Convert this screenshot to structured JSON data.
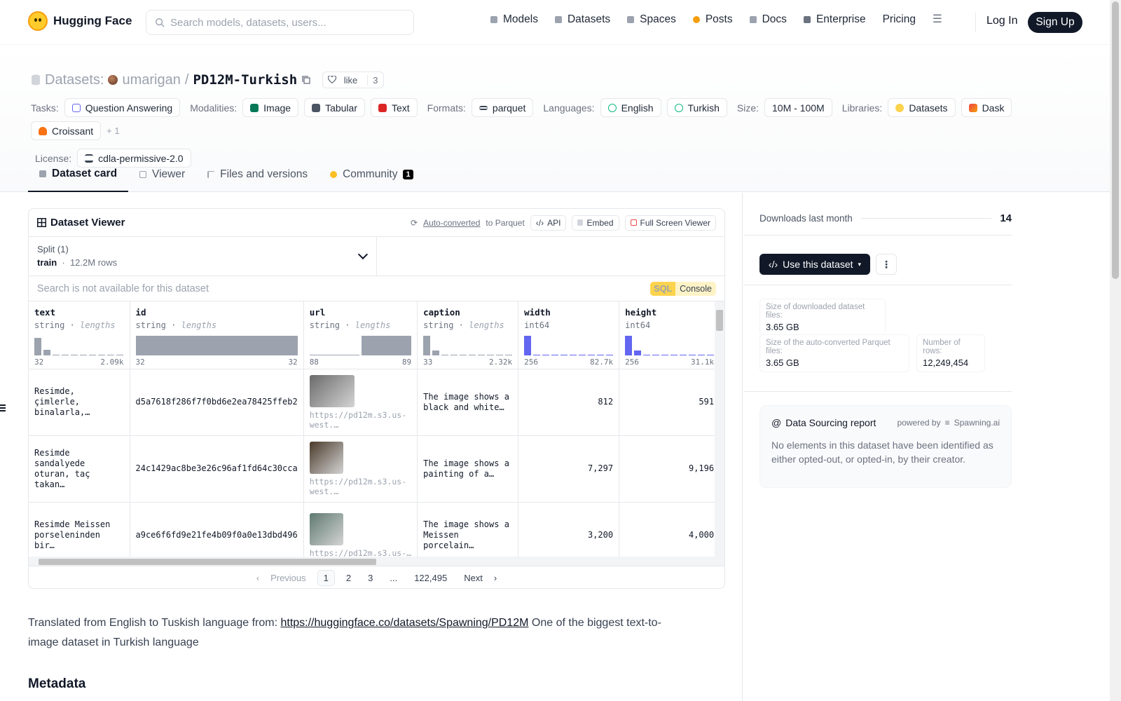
{
  "header": {
    "brand": "Hugging Face",
    "search_placeholder": "Search models, datasets, users...",
    "nav": [
      {
        "label": "Models",
        "icon": "cube-icon",
        "color": "#9ca3af"
      },
      {
        "label": "Datasets",
        "icon": "database-icon",
        "color": "#9ca3af"
      },
      {
        "label": "Spaces",
        "icon": "grid-icon",
        "color": "#9ca3af"
      },
      {
        "label": "Posts",
        "icon": "chat-icon",
        "color": "#f59e0b"
      },
      {
        "label": "Docs",
        "icon": "docs-icon",
        "color": "#9ca3af"
      },
      {
        "label": "Enterprise",
        "icon": "enterprise-icon",
        "color": "#6b7280"
      },
      {
        "label": "Pricing",
        "icon": "",
        "color": ""
      }
    ],
    "login": "Log In",
    "signup": "Sign Up"
  },
  "dataset": {
    "section_label": "Datasets:",
    "owner": "umarigan",
    "separator": "/",
    "name": "PD12M-Turkish",
    "like_label": "like",
    "like_count": "3",
    "tags": {
      "tasks_label": "Tasks:",
      "tasks": [
        "Question Answering"
      ],
      "modalities_label": "Modalities:",
      "modalities": [
        "Image",
        "Tabular",
        "Text"
      ],
      "formats_label": "Formats:",
      "formats": [
        "parquet"
      ],
      "languages_label": "Languages:",
      "languages": [
        "English",
        "Turkish"
      ],
      "size_label": "Size:",
      "size": "10M - 100M",
      "libraries_label": "Libraries:",
      "libraries": [
        "Datasets",
        "Dask",
        "Croissant"
      ],
      "libraries_more": "+ 1",
      "license_label": "License:",
      "license": "cdla-permissive-2.0"
    },
    "tabs": [
      {
        "label": "Dataset card",
        "active": true
      },
      {
        "label": "Viewer",
        "active": false
      },
      {
        "label": "Files and versions",
        "active": false
      },
      {
        "label": "Community",
        "active": false,
        "badge": "1"
      }
    ]
  },
  "viewer": {
    "title": "Dataset Viewer",
    "auto_converted": "Auto-converted",
    "to_parquet": "to Parquet",
    "api": "API",
    "embed": "Embed",
    "full_screen": "Full Screen Viewer",
    "split_label": "Split (1)",
    "split_name": "train",
    "split_rows": "12.2M rows",
    "search_disabled": "Search is not available for this dataset",
    "sql": "SQL",
    "console": "Console",
    "columns": [
      {
        "name": "text",
        "type": "string",
        "stat": "lengths",
        "min": "32",
        "max": "2.09k",
        "hist": [
          0.9,
          0.3,
          0.05,
          0.05,
          0.05,
          0.05,
          0.05,
          0.05,
          0.05,
          0.05
        ]
      },
      {
        "name": "id",
        "type": "string",
        "stat": "lengths",
        "min": "32",
        "max": "32",
        "hist": [
          1
        ]
      },
      {
        "name": "url",
        "type": "string",
        "stat": "lengths",
        "min": "88",
        "max": "89",
        "hist": [
          0.05,
          1
        ]
      },
      {
        "name": "caption",
        "type": "string",
        "stat": "lengths",
        "min": "33",
        "max": "2.32k",
        "hist": [
          1,
          0.25,
          0.05,
          0.05,
          0.05,
          0.05,
          0.05,
          0.05,
          0.05,
          0.05
        ]
      },
      {
        "name": "width",
        "type": "int64",
        "stat": "",
        "min": "256",
        "max": "82.7k",
        "hist": [
          1,
          0.05,
          0.05,
          0.05,
          0.05,
          0.05,
          0.05,
          0.05,
          0.05,
          0.05
        ]
      },
      {
        "name": "height",
        "type": "int64",
        "stat": "",
        "min": "256",
        "max": "31.1k",
        "hist": [
          1,
          0.25,
          0.05,
          0.05,
          0.05,
          0.05,
          0.05,
          0.05,
          0.05,
          0.05
        ]
      }
    ],
    "rows": [
      {
        "text": "Resimde, çimlerle, binalarla,…",
        "id": "d5a7618f286f7f0bd6e2ea78425ffeb2",
        "url": "https://pd12m.s3.us-west.…",
        "caption": "The image shows a black and white…",
        "width": "812",
        "height": "591",
        "thumb_color": "#6b6b6b"
      },
      {
        "text": "Resimde sandalyede oturan, taç takan…",
        "id": "24c1429ac8be3e26c96af1fd64c30cca",
        "url": "https://pd12m.s3.us-west.…",
        "caption": "The image shows a painting of a…",
        "width": "7,297",
        "height": "9,196",
        "thumb_color": "#4a3a2a"
      },
      {
        "text": "Resimde Meissen porseleninden bir…",
        "id": "a9ce6f6fd9e21fe4b09f0a0e13dbd496",
        "url": "https://pd12m.s3.us-…",
        "caption": "The image shows a Meissen porcelain…",
        "width": "3,200",
        "height": "4,000",
        "thumb_color": "#5f7a70"
      }
    ],
    "pager": {
      "previous": "Previous",
      "pages": [
        "1",
        "2",
        "3",
        "...",
        "122,495"
      ],
      "next": "Next"
    }
  },
  "card": {
    "intro": "Translated from English to Tuskish language from: ",
    "link": "https://huggingface.co/datasets/Spawning/PD12M",
    "outro": " One of the biggest text-to-image dataset in Turkish language",
    "metadata_heading": "Metadata"
  },
  "sidebar": {
    "downloads_label": "Downloads last month",
    "downloads_value": "14",
    "use_dataset": "Use this dataset",
    "size_downloaded_label": "Size of downloaded dataset files:",
    "size_downloaded_value": "3.65 GB",
    "size_parquet_label": "Size of the auto-converted Parquet files:",
    "size_parquet_value": "3.65 GB",
    "rows_label": "Number of rows:",
    "rows_value": "12,249,454",
    "report_title": "Data Sourcing report",
    "powered_by": "powered by",
    "spawning": "Spawning.ai",
    "report_body": "No elements in this dataset have been identified as either opted-out, or opted-in, by their creator."
  }
}
